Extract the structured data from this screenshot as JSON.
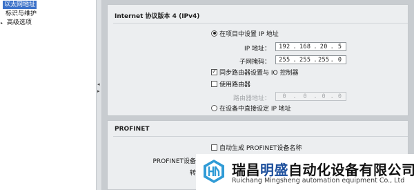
{
  "tree": {
    "items": [
      {
        "label": "以太网地址",
        "selected": true
      },
      {
        "label": "标识与维护"
      },
      {
        "label": "高级选项",
        "arrow": "▸"
      }
    ]
  },
  "ipv4": {
    "title": "Internet 协议版本 4 (IPv4)",
    "option_project": "在项目中设置 IP 地址",
    "ip_label": "IP 地址：",
    "ip": [
      "192",
      "168",
      "20",
      "5"
    ],
    "subnet_label": "子网掩码：",
    "subnet": [
      "255",
      "255",
      "255",
      "0"
    ],
    "sync_router": "同步路由器设置与 IO 控制器",
    "use_router": "使用路由器",
    "router_label": "路由器地址：",
    "router": [
      "0",
      "0",
      "0",
      "0"
    ],
    "option_device": "在设备中直接设定 IP 地址"
  },
  "profinet": {
    "title": "PROFINET",
    "auto_name": "自动生成 PROFINET设备名称",
    "name_label": "PROFINET设备名称",
    "converted_label": "转换的",
    "device_label": "设备"
  },
  "watermark": {
    "brand_a": "瑞昌",
    "brand_highlight": "明盛",
    "brand_b": "自动化设备有限公司",
    "brand_en": "Ruichang Mingsheng automation equipment Co., Ltd",
    "highlight_color": "#1d4f9c"
  },
  "colors": {
    "selection": "#3d73c9",
    "panel": "#eceef0"
  },
  "state": {
    "project_radio_selected": true,
    "sync_router_checked": true,
    "use_router_checked": false,
    "device_radio_selected": false,
    "auto_name_checked": false
  }
}
